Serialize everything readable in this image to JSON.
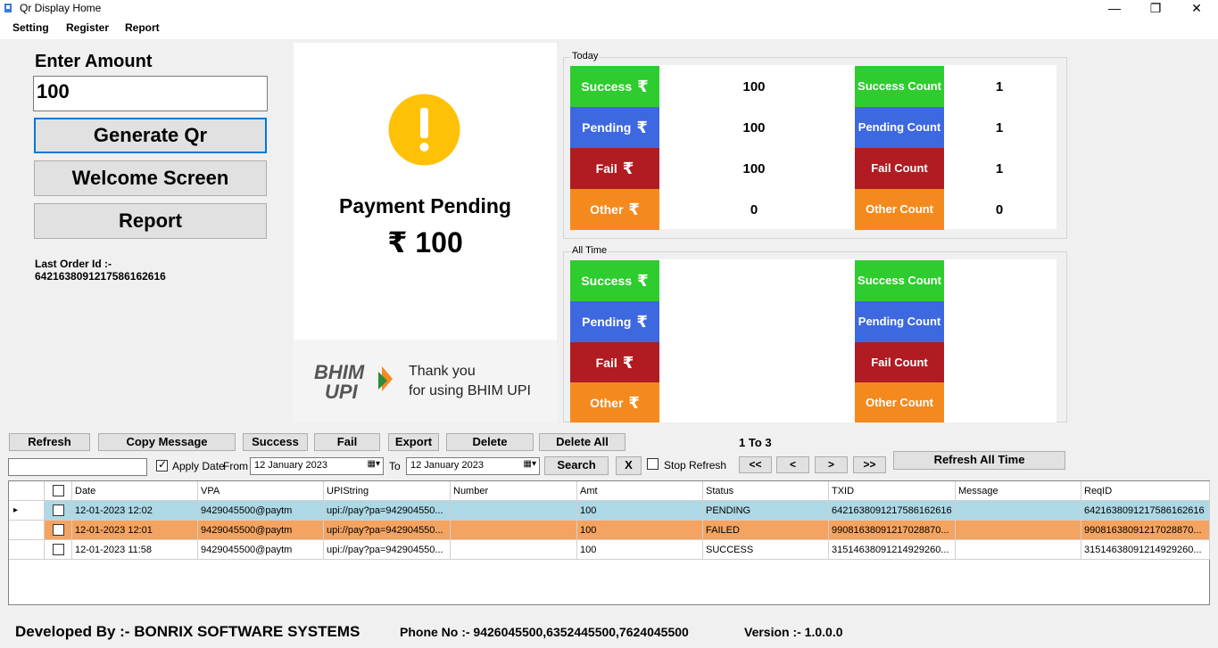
{
  "window": {
    "title": "Qr Display Home",
    "minimize": "—",
    "restore": "❐",
    "close": "✕"
  },
  "menu": [
    "Setting",
    "Register",
    "Report"
  ],
  "left": {
    "enter_amount_label": "Enter Amount",
    "amount_value": "100",
    "generate_qr": "Generate Qr",
    "welcome_screen": "Welcome Screen",
    "report": "Report",
    "last_order_label": "Last Order Id :-",
    "last_order_id": "6421638091217586162616"
  },
  "qr_panel": {
    "status": "Payment Pending",
    "amount": "₹ 100",
    "thank_you_line1": "Thank you",
    "thank_you_line2": "for using BHIM UPI",
    "logo_text_1": "BHIM",
    "logo_text_2": "UPI"
  },
  "today": {
    "label": "Today",
    "rupee": "₹",
    "tiles_left": [
      "Success",
      "Pending",
      "Fail",
      "Other"
    ],
    "values_left": [
      "100",
      "100",
      "100",
      "0"
    ],
    "tiles_right": [
      "Success Count",
      "Pending Count",
      "Fail Count",
      "Other Count"
    ],
    "values_right": [
      "1",
      "1",
      "1",
      "0"
    ]
  },
  "all_time": {
    "label": "All Time",
    "tiles_left": [
      "Success",
      "Pending",
      "Fail",
      "Other"
    ],
    "tiles_right": [
      "Success Count",
      "Pending Count",
      "Fail Count",
      "Other Count"
    ]
  },
  "toolbar": {
    "refresh": "Refresh",
    "copy_message": "Copy Message",
    "success": "Success",
    "fail": "Fail",
    "export": "Export",
    "delete": "Delete",
    "delete_all": "Delete All",
    "page_info": "1 To 3",
    "apply_date": "Apply Date",
    "from": "From",
    "to": "To",
    "date_from": "12   January    2023",
    "date_to": "12   January    2023",
    "search": "Search",
    "clear": "X",
    "stop_refresh": "Stop Refresh",
    "first": "<<",
    "prev": "<",
    "next": ">",
    "last": ">>",
    "refresh_all_time": "Refresh All Time",
    "search_value": ""
  },
  "grid": {
    "columns": [
      "Date",
      "VPA",
      "UPIString",
      "Number",
      "Amt",
      "Status",
      "TXID",
      "Message",
      "ReqID"
    ],
    "rows": [
      {
        "date": "12-01-2023 12:02",
        "vpa": "9429045500@paytm",
        "upi": "upi://pay?pa=942904550...",
        "number": "",
        "amt": "100",
        "status": "PENDING",
        "txid": "6421638091217586162616",
        "message": "",
        "reqid": "6421638091217586162616",
        "color": "#add8e6"
      },
      {
        "date": "12-01-2023 12:01",
        "vpa": "9429045500@paytm",
        "upi": "upi://pay?pa=942904550...",
        "number": "",
        "amt": "100",
        "status": "FAILED",
        "txid": "9908163809121702887​0...",
        "message": "",
        "reqid": "99081638091217028870...",
        "color": "#f4a460"
      },
      {
        "date": "12-01-2023 11:58",
        "vpa": "9429045500@paytm",
        "upi": "upi://pay?pa=942904550...",
        "number": "",
        "amt": "100",
        "status": "SUCCESS",
        "txid": "31514638091214929260...",
        "message": "",
        "reqid": "31514638091214929260...",
        "color": "#ffffff"
      }
    ]
  },
  "footer": {
    "developed_by": "Developed By :- BONRIX SOFTWARE SYSTEMS",
    "phone": "Phone No :- 9426045500,6352445500,7624045500",
    "version": "Version :- 1.0.0.0"
  },
  "colors": {
    "success": "#2ecc2e",
    "pending": "#3d68e0",
    "fail": "#b01c22",
    "other": "#f48a1e",
    "warning": "#ffc107"
  }
}
